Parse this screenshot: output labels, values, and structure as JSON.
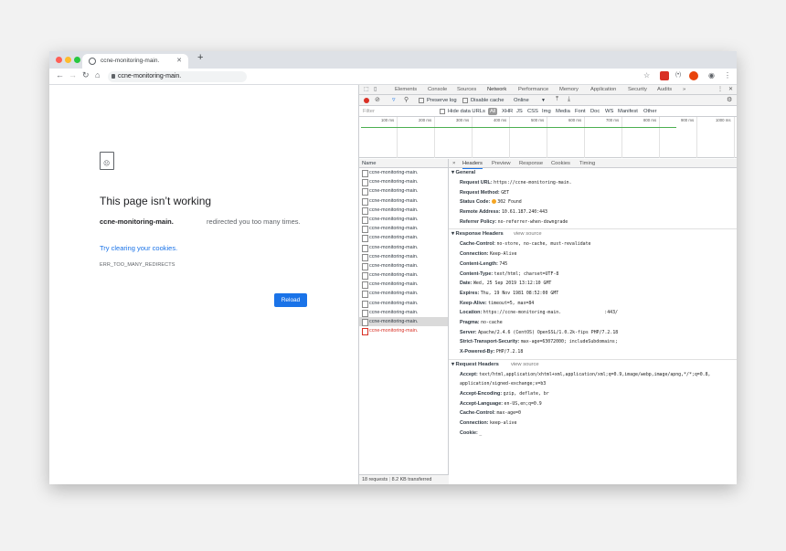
{
  "browser": {
    "tab_title": "ccne-monitoring-main.",
    "url": "ccne-monitoring-main.",
    "new_tab": "+"
  },
  "error_page": {
    "title": "This page isn’t working",
    "host": "ccne-monitoring-main.",
    "message_tail": "redirected you too many times.",
    "suggestion": "Try clearing your cookies.",
    "code": "ERR_TOO_MANY_REDIRECTS",
    "reload": "Reload"
  },
  "devtools": {
    "tabs": [
      "Elements",
      "Console",
      "Sources",
      "Network",
      "Performance",
      "Memory",
      "Application",
      "Security",
      "Audits",
      "»"
    ],
    "active_tab": "Network",
    "toolbar": {
      "preserve_log": "Preserve log",
      "disable_cache": "Disable cache",
      "throttle": "Online"
    },
    "filter": {
      "placeholder": "Filter",
      "hide_data_urls": "Hide data URLs",
      "types": [
        "All",
        "XHR",
        "JS",
        "CSS",
        "Img",
        "Media",
        "Font",
        "Doc",
        "WS",
        "Manifest",
        "Other"
      ]
    },
    "timeline_ticks": [
      "100 ms",
      "200 ms",
      "300 ms",
      "400 ms",
      "500 ms",
      "600 ms",
      "700 ms",
      "800 ms",
      "900 ms",
      "1000 ms"
    ],
    "name_header": "Name",
    "requests": [
      "ccne-monitoring-main.",
      "ccne-monitoring-main.",
      "ccne-monitoring-main.",
      "ccne-monitoring-main.",
      "ccne-monitoring-main.",
      "ccne-monitoring-main.",
      "ccne-monitoring-main.",
      "ccne-monitoring-main.",
      "ccne-monitoring-main.",
      "ccne-monitoring-main.",
      "ccne-monitoring-main.",
      "ccne-monitoring-main.",
      "ccne-monitoring-main.",
      "ccne-monitoring-main.",
      "ccne-monitoring-main.",
      "ccne-monitoring-main.",
      "ccne-monitoring-main.",
      "ccne-monitoring-main."
    ],
    "status_requests": "18 requests",
    "status_transferred": "8.2 KB transferred",
    "detail_tabs": [
      "×",
      "Headers",
      "Preview",
      "Response",
      "Cookies",
      "Timing"
    ],
    "general": {
      "title": "▾ General",
      "rows": [
        {
          "k": "Request URL:",
          "v": "https://ccne-monitoring-main."
        },
        {
          "k": "Request Method:",
          "v": "GET"
        },
        {
          "k": "Status Code:",
          "v": "302 Found"
        },
        {
          "k": "Remote Address:",
          "v": "10.61.187.240:443"
        },
        {
          "k": "Referrer Policy:",
          "v": "no-referrer-when-downgrade"
        }
      ]
    },
    "response_headers": {
      "title": "▾ Response Headers",
      "view_source": "view source",
      "rows": [
        {
          "k": "Cache-Control:",
          "v": "no-store, no-cache, must-revalidate"
        },
        {
          "k": "Connection:",
          "v": "Keep-Alive"
        },
        {
          "k": "Content-Length:",
          "v": "745"
        },
        {
          "k": "Content-Type:",
          "v": "text/html; charset=UTF-8"
        },
        {
          "k": "Date:",
          "v": "Wed, 25 Sep 2019 13:12:10 GMT"
        },
        {
          "k": "Expires:",
          "v": "Thu, 19 Nov 1981 08:52:00 GMT"
        },
        {
          "k": "Keep-Alive:",
          "v": "timeout=5, max=84"
        },
        {
          "k": "Location:",
          "v": "https://ccne-monitoring-main.                :443/"
        },
        {
          "k": "Pragma:",
          "v": "no-cache"
        },
        {
          "k": "Server:",
          "v": "Apache/2.4.6 (CentOS) OpenSSL/1.0.2k-fips PHP/7.2.18"
        },
        {
          "k": "Strict-Transport-Security:",
          "v": "max-age=63072000; includeSubdomains;"
        },
        {
          "k": "X-Powered-By:",
          "v": "PHP/7.2.18"
        }
      ]
    },
    "request_headers": {
      "title": "▾ Request Headers",
      "view_source": "view source",
      "accept_value": "text/html,application/xhtml+xml,application/xml;q=0.9,image/webp,image/apng,*/*;q=0.8,",
      "accept_value_cont": "application/signed-exchange;v=b3",
      "rows": [
        {
          "k": "Accept-Encoding:",
          "v": "gzip, deflate, br"
        },
        {
          "k": "Accept-Language:",
          "v": "en-US,en;q=0.9"
        },
        {
          "k": "Cache-Control:",
          "v": "max-age=0"
        },
        {
          "k": "Connection:",
          "v": "keep-alive"
        },
        {
          "k": "Cookie:",
          "v": "_"
        }
      ]
    }
  },
  "colors": {
    "accent": "#1a73e8",
    "error": "#d93025",
    "status_ok": "#f5a623"
  }
}
